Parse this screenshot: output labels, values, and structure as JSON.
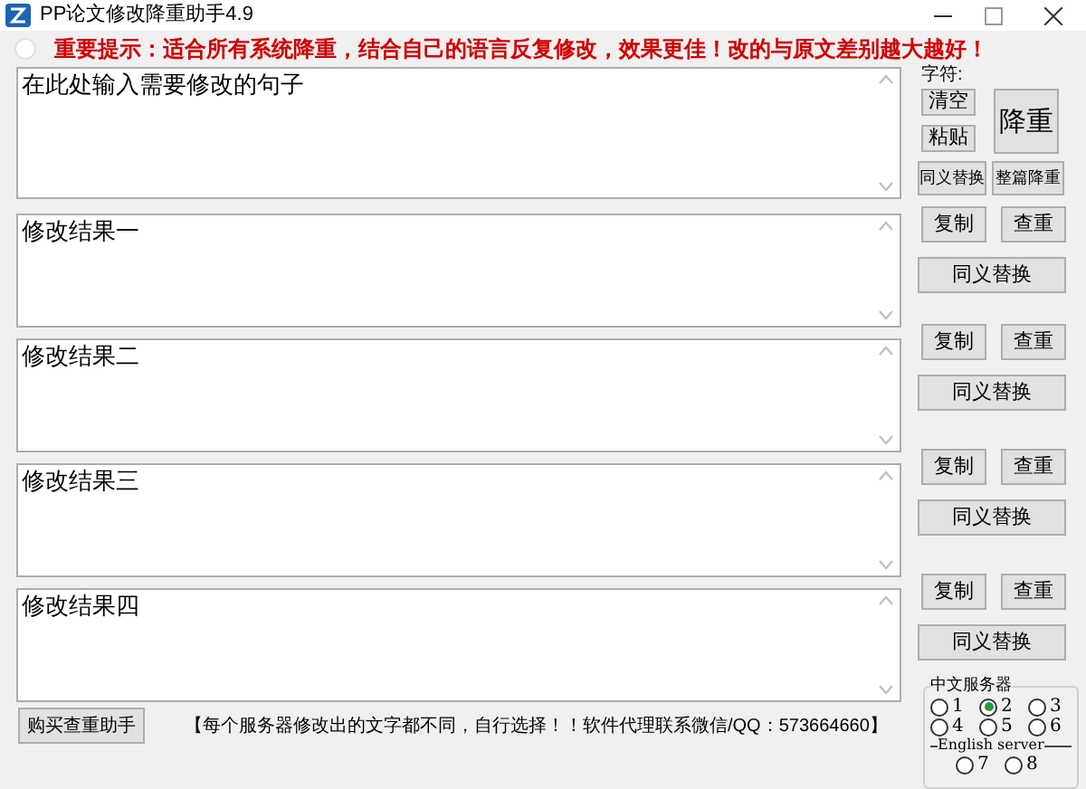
{
  "window": {
    "title": "PP论文修改降重助手4.9"
  },
  "notice": {
    "checked": false,
    "text": "重要提示：适合所有系统降重，结合自己的语言反复修改，效果更佳！改的与原文差别越大越好！"
  },
  "input": {
    "value": "在此处输入需要修改的句子",
    "char_label": "字符:",
    "clear_button": "清空",
    "paste_button": "粘贴",
    "reduce_button": "降重",
    "synonym_button": "同义替换",
    "whole_button": "整篇降重"
  },
  "results": [
    {
      "value": "修改结果一",
      "copy_button": "复制",
      "check_button": "查重",
      "synonym_button": "同义替换"
    },
    {
      "value": "修改结果二",
      "copy_button": "复制",
      "check_button": "查重",
      "synonym_button": "同义替换"
    },
    {
      "value": "修改结果三",
      "copy_button": "复制",
      "check_button": "查重",
      "synonym_button": "同义替换"
    },
    {
      "value": "修改结果四",
      "copy_button": "复制",
      "check_button": "查重",
      "synonym_button": "同义替换"
    }
  ],
  "buy_button": "购买查重助手",
  "footer_note": "【每个服务器修改出的文字都不同，自行选择！！软件代理联系微信/QQ：573664660】",
  "servers": {
    "title": "中文服务器",
    "groups": [
      {
        "options": [
          {
            "label": "1",
            "selected": false
          },
          {
            "label": "2",
            "selected": true
          },
          {
            "label": "3",
            "selected": false
          },
          {
            "label": "4",
            "selected": false
          },
          {
            "label": "5",
            "selected": false
          },
          {
            "label": "6",
            "selected": false
          }
        ]
      },
      {
        "label": "English server",
        "options": [
          {
            "label": "7",
            "selected": false
          },
          {
            "label": "8",
            "selected": false
          }
        ]
      }
    ]
  }
}
